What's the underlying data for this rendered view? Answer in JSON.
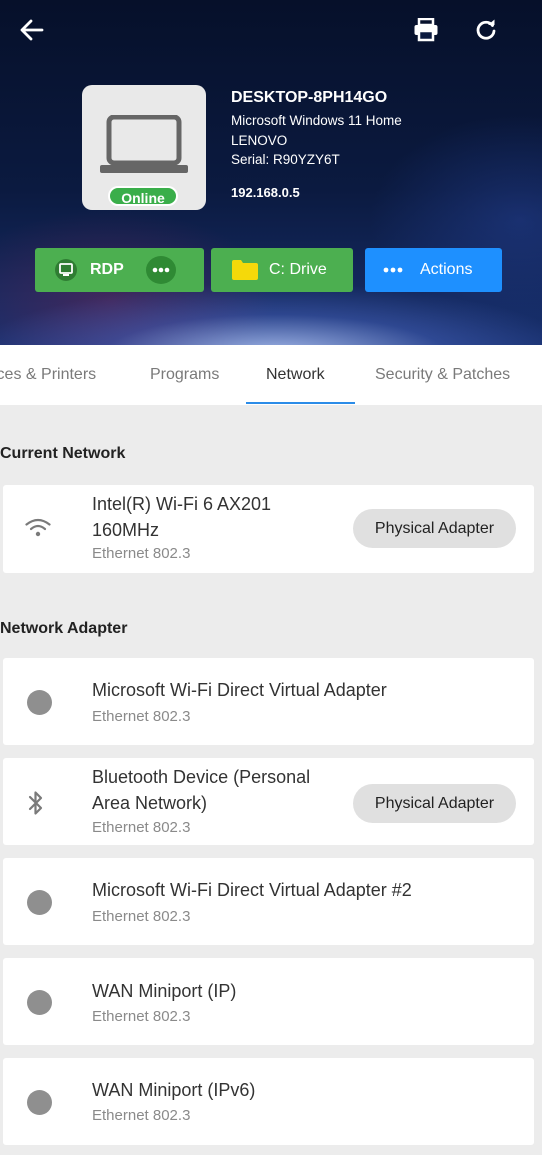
{
  "device": {
    "name": "DESKTOP-8PH14GO",
    "os": "Microsoft Windows 11 Home",
    "manufacturer": "LENOVO",
    "serial": "Serial: R90YZY6T",
    "ip": "192.168.0.5",
    "status": "Online"
  },
  "header_icons": [
    "back-arrow-icon",
    "print-icon",
    "refresh-icon"
  ],
  "buttons": {
    "rdp": "RDP",
    "cdrive": "C: Drive",
    "actions": "Actions"
  },
  "tabs": [
    "ices & Printers",
    "Programs",
    "Network",
    "Security & Patches"
  ],
  "active_tab": "Network",
  "sections": {
    "current": "Current Network",
    "adapters": "Network Adapter"
  },
  "current_network": {
    "title": "Intel(R) Wi-Fi 6 AX201 160MHz",
    "subtitle": "Ethernet 802.3",
    "chip": "Physical Adapter",
    "icon": "wifi-icon"
  },
  "adapters": [
    {
      "title": "Microsoft Wi-Fi Direct Virtual Adapter",
      "subtitle": "Ethernet 802.3",
      "icon": "dot-icon"
    },
    {
      "title": "Bluetooth Device (Personal Area Network)",
      "subtitle": "Ethernet 802.3",
      "chip": "Physical Adapter",
      "icon": "bluetooth-icon"
    },
    {
      "title": "Microsoft Wi-Fi Direct Virtual Adapter #2",
      "subtitle": "Ethernet 802.3",
      "icon": "dot-icon"
    },
    {
      "title": "WAN Miniport (IP)",
      "subtitle": "Ethernet 802.3",
      "icon": "dot-icon"
    },
    {
      "title": "WAN Miniport (IPv6)",
      "subtitle": "Ethernet 802.3",
      "icon": "dot-icon"
    }
  ],
  "colors": {
    "green": "#4caf50",
    "blue": "#1e90ff",
    "tab_underline": "#2b8ce8",
    "folder": "#f5d90a"
  }
}
